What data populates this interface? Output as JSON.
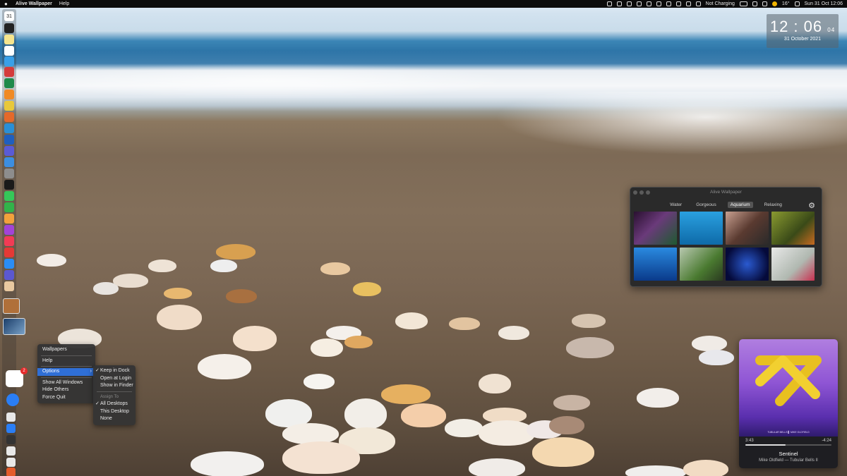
{
  "menubar": {
    "app_name": "Alive Wallpaper",
    "help": "Help",
    "temperature": "16°",
    "battery_status": "Not Charging",
    "datetime": "Sun 31 Oct 12:06"
  },
  "clock": {
    "hours": "12",
    "minutes": "06",
    "seconds": "04",
    "date": "31 October 2021"
  },
  "dock": {
    "calendar_day": "31",
    "notification_badge": "2"
  },
  "context_menu": {
    "wallpapers": "Wallpapers",
    "help": "Help",
    "options": "Options",
    "show_all_windows": "Show All Windows",
    "hide_others": "Hide Others",
    "force_quit": "Force Quit"
  },
  "submenu": {
    "keep_in_dock": "Keep in Dock",
    "open_at_login": "Open at Login",
    "show_in_finder": "Show in Finder",
    "assign_to_header": "Assign To",
    "all_desktops": "All Desktops",
    "this_desktop": "This Desktop",
    "none": "None"
  },
  "alive_window": {
    "title": "Alive Wallpaper",
    "tabs": [
      {
        "label": "Water",
        "active": false
      },
      {
        "label": "Gorgeous",
        "active": false
      },
      {
        "label": "Aquarium",
        "active": true
      },
      {
        "label": "Relaxing",
        "active": false
      }
    ],
    "thumbnail_colors": [
      "#4a2350",
      "#1e8fd0",
      "#7a5a4a",
      "#6a7a2a",
      "#1c6fbf",
      "#6f8a50",
      "#0a1a5a",
      "#c8c8c8"
    ]
  },
  "music": {
    "art_text": "TUBULAR BELLS ▌ MIKE OLDFIELD",
    "elapsed": "3:43",
    "remaining": "-4:24",
    "progress": 0.47,
    "song": "Sentinel",
    "artist_album": "Mike Oldfield — Tubular Bells II"
  },
  "colors": {
    "accent": "#2f6fd6",
    "menubar_bg": "#0c0c0c"
  }
}
